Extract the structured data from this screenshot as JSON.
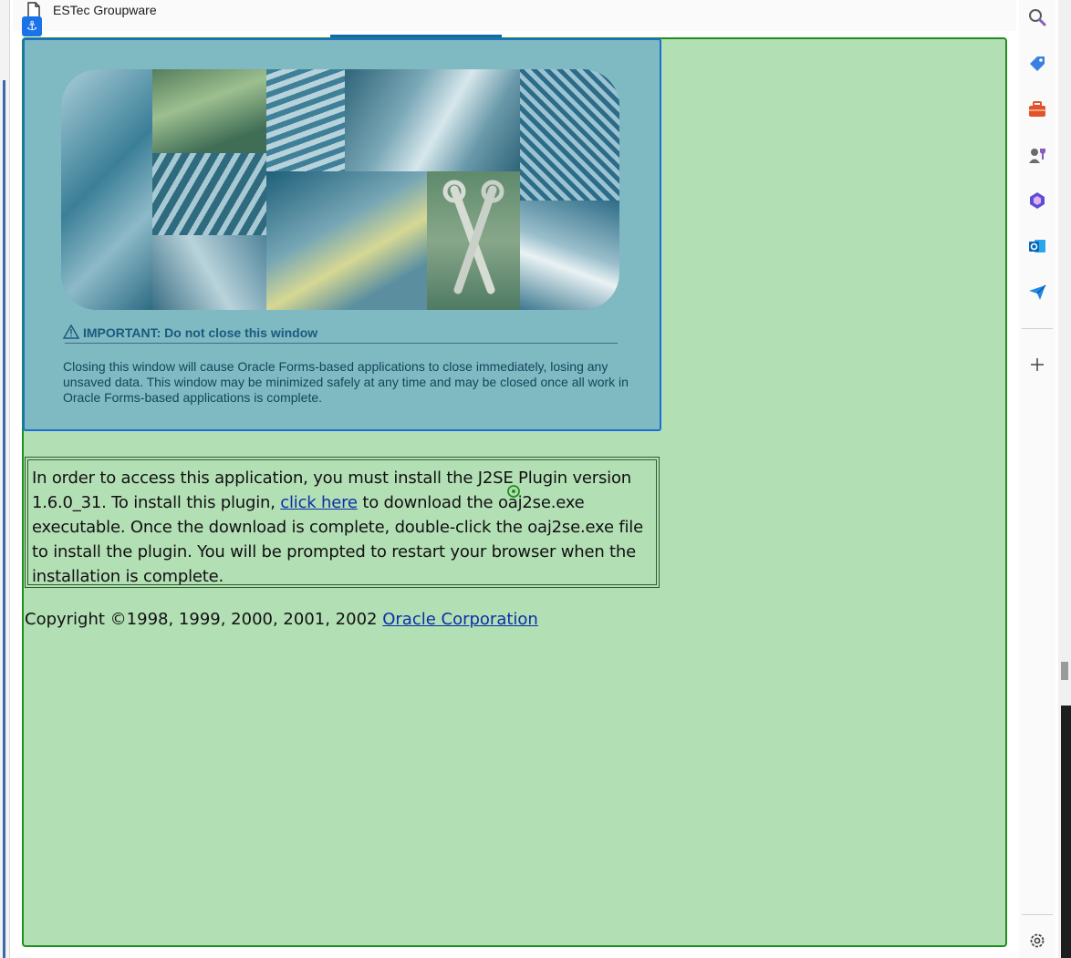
{
  "window": {
    "title": "ESTec Groupware",
    "anchor_glyph": "⚓"
  },
  "banner": {
    "important_label": "IMPORTANT: Do not close this window",
    "body": "Closing this window will cause Oracle Forms-based applications to close immediately, losing any unsaved data. This window may be minimized safely at any time and may be closed once all work in Oracle Forms-based applications is complete."
  },
  "notice": {
    "text_before_link": "In order to access this application, you must install the J2SE Plugin version 1.6.0_31. To install this plugin, ",
    "link_label": "click here",
    "text_after_link": " to download the oaj2se.exe executable. Once the download is complete, double-click the oaj2se.exe file to install the plugin. You will be prompted to restart your browser when the installation is complete."
  },
  "footer": {
    "copyright_text": "Copyright ©1998, 1999, 2000, 2001, 2002 ",
    "company_link": "Oracle Corporation"
  },
  "sidebar": {
    "items": [
      {
        "icon": "search-icon"
      },
      {
        "icon": "tag-icon"
      },
      {
        "icon": "toolbox-icon"
      },
      {
        "icon": "games-icon"
      },
      {
        "icon": "copilot-icon"
      },
      {
        "icon": "outlook-icon"
      },
      {
        "icon": "send-icon"
      },
      {
        "icon": "add-icon"
      },
      {
        "icon": "settings-icon"
      }
    ]
  },
  "colors": {
    "highlight_fill": "#b3dfb5",
    "highlight_border": "#1f8f1f",
    "banner_fill": "#7fb9c2",
    "banner_border": "#1a6fd6",
    "link": "#0b2fa8"
  }
}
